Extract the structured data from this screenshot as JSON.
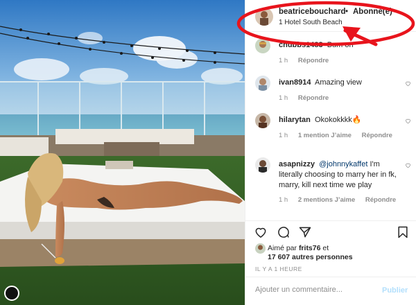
{
  "post": {
    "username": "beatricebouchard",
    "separator": "•",
    "follow_status": "Abonné(e)",
    "location": "1 Hotel South Beach"
  },
  "comments": [
    {
      "username": "chubbs1483",
      "text": "Bum on",
      "time": "1 h",
      "likes": "",
      "reply": "Répondre"
    },
    {
      "username": "ivan8914",
      "text": "Amazing view",
      "time": "1 h",
      "likes": "",
      "reply": "Répondre"
    },
    {
      "username": "hilarytan",
      "text": "Okokokkkk🔥",
      "time": "1 h",
      "likes": "1 mention J’aime",
      "reply": "Répondre"
    },
    {
      "username": "asapnizzy",
      "mention": "@johnnykaffet",
      "text": "I'm literally choosing to marry her in fk, marry, kill next time we play",
      "time": "1 h",
      "likes": "2 mentions J’aime",
      "reply": "Répondre"
    }
  ],
  "likes": {
    "prefix": "Aimé par",
    "by": "frits76",
    "and": "et",
    "others": "17 607 autres personnes"
  },
  "timestamp": "IL Y A 1 HEURE",
  "comment_box": {
    "placeholder": "Ajouter un commentaire...",
    "publish_label": "Publier"
  },
  "colors": {
    "annotation": "#e8141c",
    "link": "#00376b",
    "publish_disabled": "#b2dffc",
    "muted": "#8e8e8e"
  },
  "icons": [
    "heart-icon",
    "comment-icon",
    "share-icon",
    "bookmark-icon"
  ]
}
